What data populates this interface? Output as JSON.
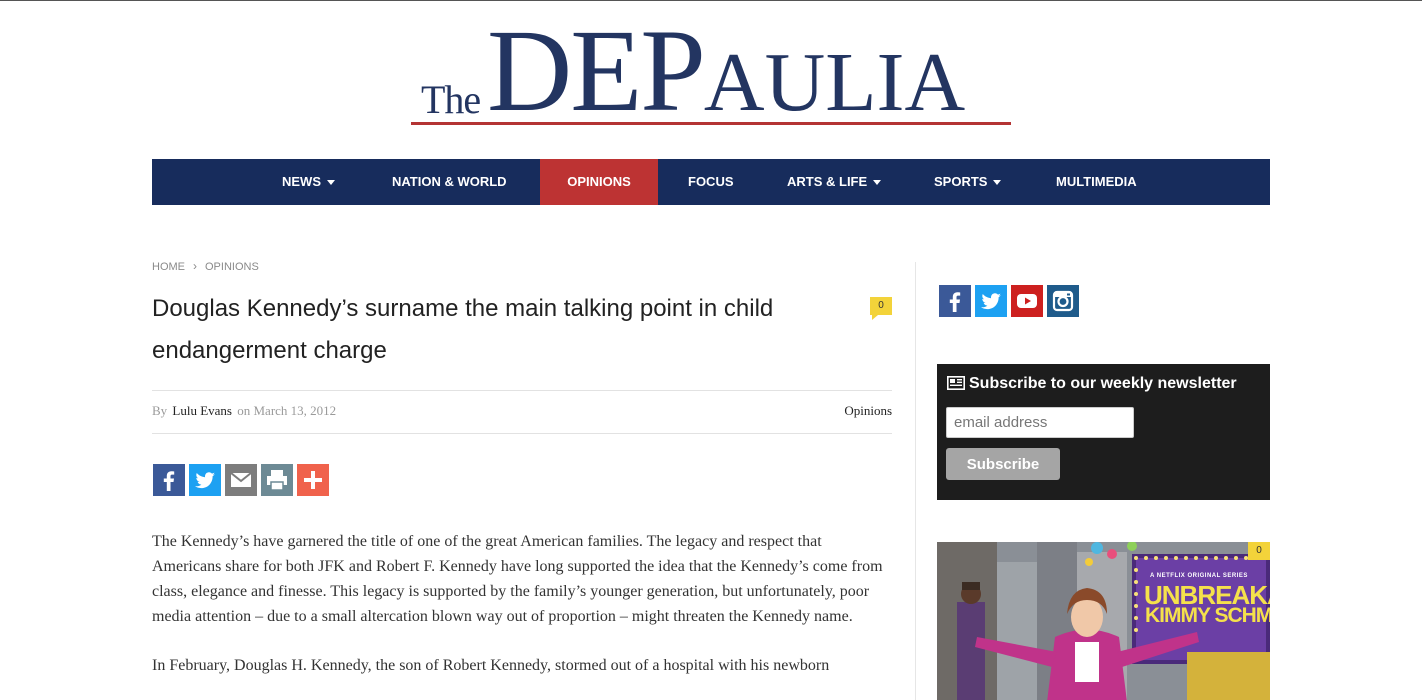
{
  "masthead": {
    "the": "The",
    "main_big": "DEP",
    "main_small": "AULIA"
  },
  "nav": {
    "items": [
      {
        "label": "NEWS",
        "dropdown": true
      },
      {
        "label": "NATION & WORLD",
        "dropdown": false
      },
      {
        "label": "OPINIONS",
        "dropdown": false,
        "active": true
      },
      {
        "label": "FOCUS",
        "dropdown": false
      },
      {
        "label": "ARTS & LIFE",
        "dropdown": true
      },
      {
        "label": "SPORTS",
        "dropdown": true
      },
      {
        "label": "MULTIMEDIA",
        "dropdown": false
      }
    ]
  },
  "breadcrumb": {
    "home": "HOME",
    "separator": "›",
    "current": "OPINIONS"
  },
  "article": {
    "title": "Douglas Kennedy’s surname the main talking point in child endangerment charge",
    "comment_count": "0",
    "by": "By",
    "author": "Lulu Evans",
    "on": "on",
    "date": "March 13, 2012",
    "category": "Opinions",
    "paragraphs": [
      "The Kennedy’s have garnered the title of one of the great American families. The legacy and respect that Americans share for both JFK and Robert F. Kennedy have long supported the idea that the Kennedy’s come from class, elegance and finesse. This legacy is supported by the family’s younger generation, but unfortunately, poor media attention – due to a small altercation blown way out of proportion – might threaten the Kennedy name.",
      "In February, Douglas H. Kennedy, the son of Robert Kennedy, stormed out of a hospital with his newborn"
    ]
  },
  "share": {
    "buttons": [
      {
        "name": "facebook-icon",
        "color": "#3b5998"
      },
      {
        "name": "twitter-icon",
        "color": "#1da1f2"
      },
      {
        "name": "email-icon",
        "color": "#7d7d7d"
      },
      {
        "name": "print-icon",
        "color": "#6d8a95"
      },
      {
        "name": "plus-icon",
        "color": "#f0624c"
      }
    ]
  },
  "social": {
    "buttons": [
      {
        "name": "facebook-icon",
        "color": "#3b5998"
      },
      {
        "name": "twitter-icon",
        "color": "#1da1f2"
      },
      {
        "name": "youtube-icon",
        "color": "#cd201f"
      },
      {
        "name": "instagram-icon",
        "color": "#1f5b8b"
      }
    ]
  },
  "newsletter": {
    "title": "Subscribe to our weekly newsletter",
    "placeholder": "email address",
    "button": "Subscribe"
  },
  "promo": {
    "comment_count": "0",
    "top_line": "A NETFLIX ORIGINAL SERIES",
    "title_line1": "UNBREAKABLE",
    "title_line2": "KIMMY SCHMIDT"
  },
  "colors": {
    "nav_bg": "#172c5c",
    "nav_active": "#bd3333",
    "logo": "#233561",
    "logo_rule": "#b43434",
    "badge": "#f3d33a"
  }
}
